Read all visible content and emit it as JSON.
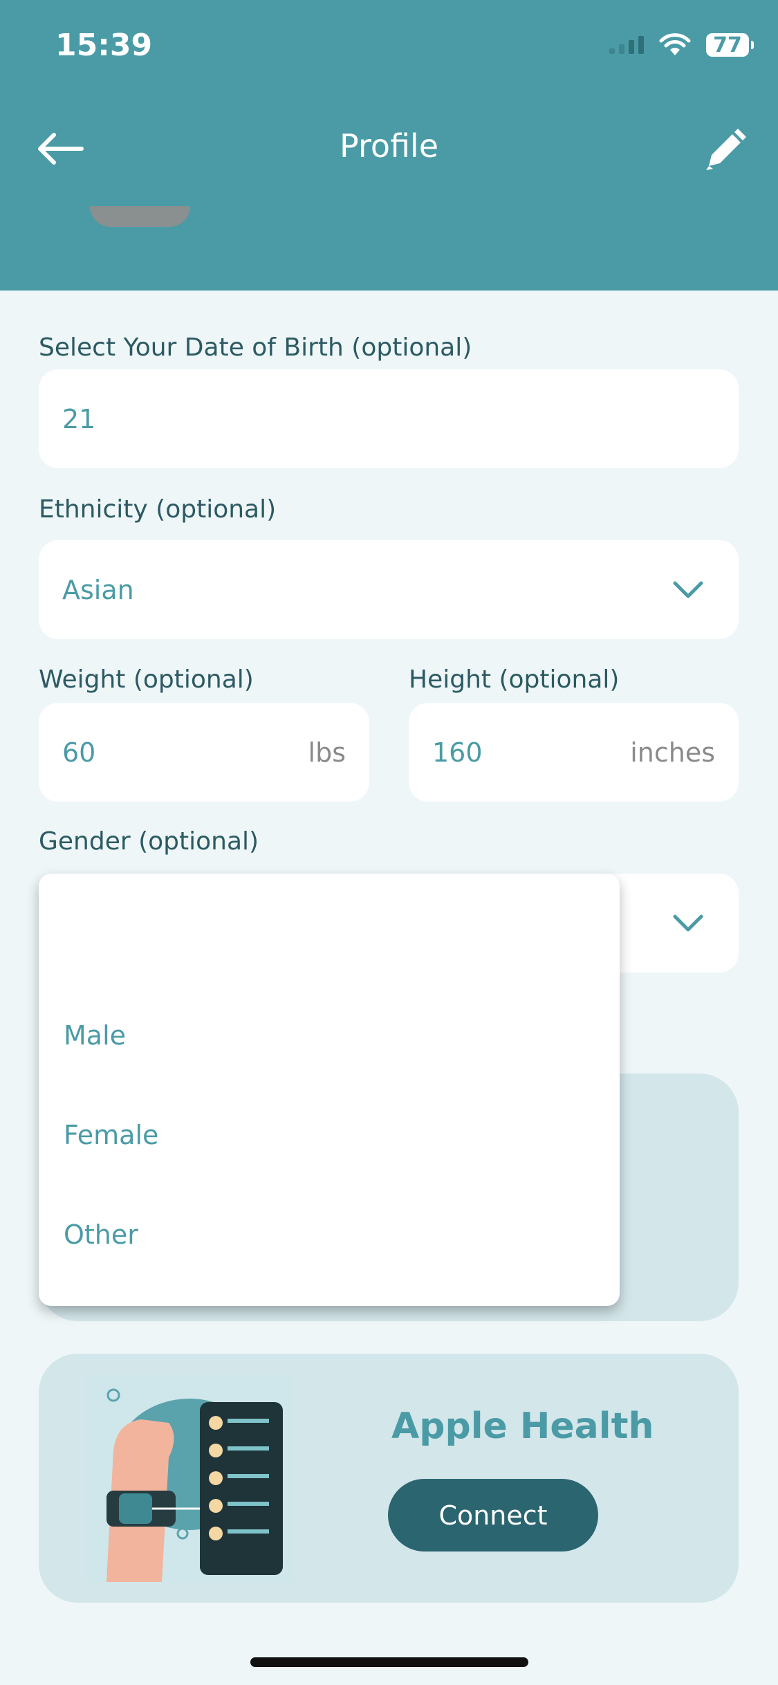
{
  "status_bar": {
    "time": "15:39",
    "battery": "77"
  },
  "header": {
    "title": "Profile"
  },
  "form": {
    "dob": {
      "label": "Select Your Date of Birth (optional)",
      "value": "21"
    },
    "ethnicity": {
      "label": "Ethnicity (optional)",
      "value": "Asian"
    },
    "weight": {
      "label": "Weight (optional)",
      "value": "60",
      "unit": "lbs"
    },
    "height": {
      "label": "Height (optional)",
      "value": "160",
      "unit": "inches"
    },
    "gender": {
      "label": "Gender (optional)",
      "value": ""
    }
  },
  "gender_dropdown": {
    "options": [
      "Male",
      "Female",
      "Other"
    ]
  },
  "apple_health": {
    "title": "Apple Health",
    "button": "Connect"
  },
  "colors": {
    "primary": "#4A9BA6",
    "dark": "#2A6570",
    "card": "#D3E6EA",
    "background": "#EEF6F8"
  }
}
